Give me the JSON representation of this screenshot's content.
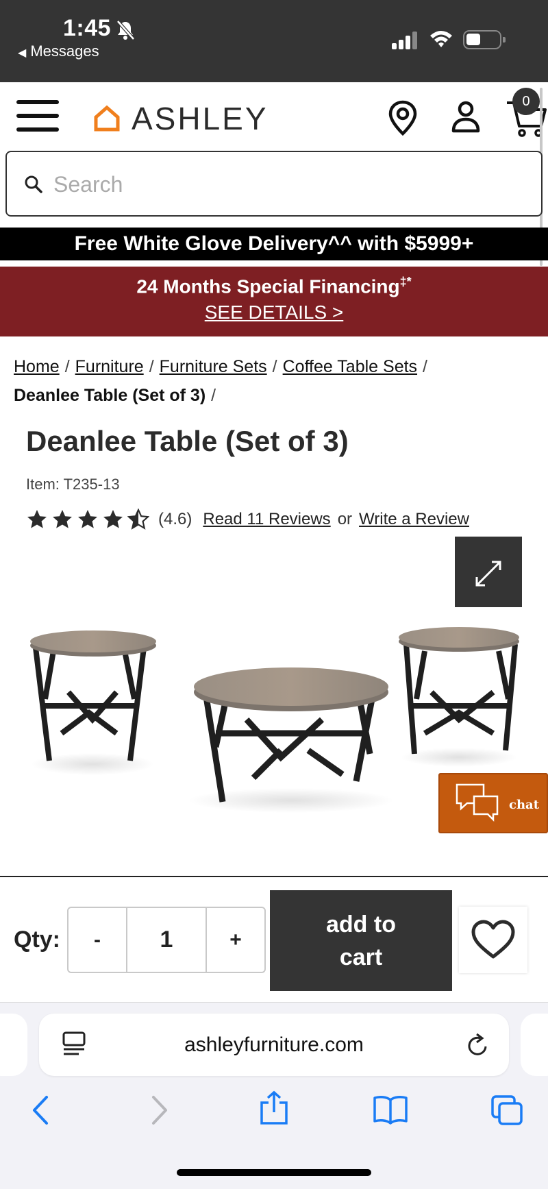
{
  "status_bar": {
    "time": "1:45",
    "back_label": "Messages"
  },
  "header": {
    "brand": "ASHLEY",
    "cart_count": "0",
    "icons": [
      "hamburger-menu-icon",
      "map-pin-icon",
      "account-icon",
      "cart-icon"
    ]
  },
  "search": {
    "placeholder": "Search"
  },
  "promos": {
    "delivery": "Free White Glove Delivery^^ with $5999+",
    "financing": "24 Months Special Financing",
    "financing_mark": "‡*",
    "financing_link": "SEE DETAILS >"
  },
  "breadcrumb": {
    "items": [
      "Home",
      "Furniture",
      "Furniture Sets",
      "Coffee Table Sets"
    ],
    "current": "Deanlee Table (Set of 3)"
  },
  "product": {
    "title": "Deanlee Table (Set of 3)",
    "item_number": "Item: T235-13",
    "rating": 4.6,
    "rating_text": "(4.6)",
    "read_reviews": "Read 11 Reviews",
    "or_text": "or",
    "write_review": "Write a Review"
  },
  "chat": {
    "label": "chat",
    "color": "#c45a0e"
  },
  "purchase": {
    "qty_label": "Qty:",
    "minus": "-",
    "qty_value": "1",
    "plus": "+",
    "add_line1": "add to",
    "add_line2": "cart"
  },
  "browser": {
    "url": "ashleyfurniture.com"
  },
  "colors": {
    "brand_orange": "#f07f1d",
    "financing_red": "#7e1f23",
    "dark": "#343434"
  }
}
